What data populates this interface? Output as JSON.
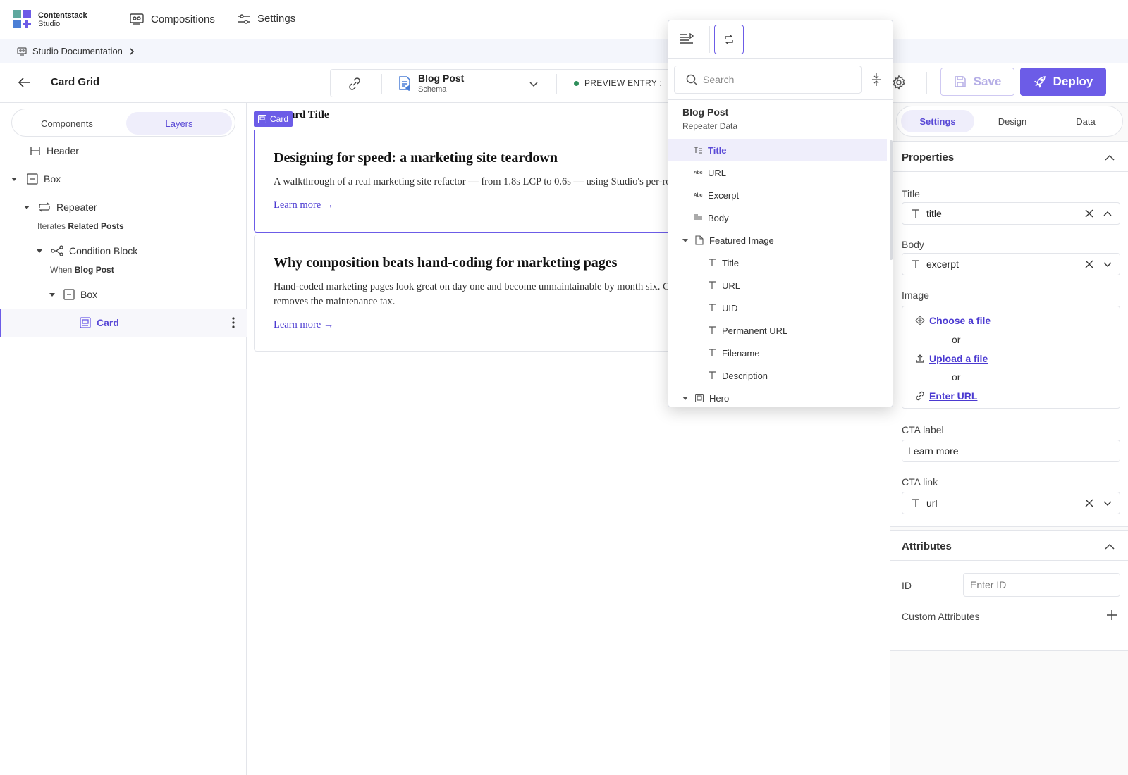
{
  "brand": {
    "name": "Contentstack",
    "product": "Studio"
  },
  "nav": {
    "compositions": "Compositions",
    "settings": "Settings"
  },
  "breadcrumb": {
    "project": "Studio Documentation"
  },
  "toolbar": {
    "title": "Card Grid",
    "schema_name": "Blog Post",
    "schema_type": "Schema",
    "preview_label": "PREVIEW ENTRY :",
    "save_label": "Save",
    "deploy_label": "Deploy"
  },
  "left": {
    "tabs": [
      "Components",
      "Layers"
    ],
    "active_tab": "Layers",
    "tree": {
      "header": "Header",
      "box": "Box",
      "repeater": "Repeater",
      "repeater_sub_prefix": "Iterates",
      "repeater_sub_value": "Related Posts",
      "condition": "Condition Block",
      "condition_sub_prefix": "When",
      "condition_sub_value": "Blog Post",
      "box2": "Box",
      "card": "Card"
    }
  },
  "canvas": {
    "card_tag": "Card",
    "behind_title": "Card Title",
    "cards": [
      {
        "title": "Designing for speed: a marketing site teardown",
        "body": "A walkthrough of a real marketing site refactor — from 1.8s LCP to 0.6s — using Studio's per-ro",
        "link": "Learn more →"
      },
      {
        "title": "Why composition beats hand-coding for marketing pages",
        "body": "Hand-coded marketing pages look great on day one and become unmaintainable by month six. C",
        "body2": "removes the maintenance tax.",
        "link": "Learn more →"
      }
    ]
  },
  "popover": {
    "search_placeholder": "Search",
    "group_title": "Blog Post",
    "group_subtitle": "Repeater Data",
    "items": {
      "title": "Title",
      "url": "URL",
      "excerpt": "Excerpt",
      "body": "Body",
      "featured_image": "Featured Image",
      "fi_title": "Title",
      "fi_url": "URL",
      "fi_uid": "UID",
      "fi_permanent_url": "Permanent URL",
      "fi_filename": "Filename",
      "fi_description": "Description",
      "hero": "Hero"
    }
  },
  "right": {
    "tabs": [
      "Settings",
      "Design",
      "Data"
    ],
    "active_tab": "Settings",
    "properties": {
      "heading": "Properties",
      "title_label": "Title",
      "title_value": "title",
      "body_label": "Body",
      "body_value": "excerpt",
      "image_label": "Image",
      "choose_file": "Choose a file",
      "or1": "or",
      "upload_file": "Upload a file",
      "or2": "or",
      "enter_url": "Enter URL",
      "cta_label_label": "CTA label",
      "cta_label_value": "Learn more",
      "cta_link_label": "CTA link",
      "cta_link_value": "url"
    },
    "attributes": {
      "heading": "Attributes",
      "id_label": "ID",
      "id_placeholder": "Enter ID",
      "custom_label": "Custom Attributes"
    }
  },
  "colors": {
    "accent": "#6c5ce7",
    "accent_light": "#efeefb",
    "link": "#4b3ad1",
    "status_green": "#2f8f5b"
  }
}
